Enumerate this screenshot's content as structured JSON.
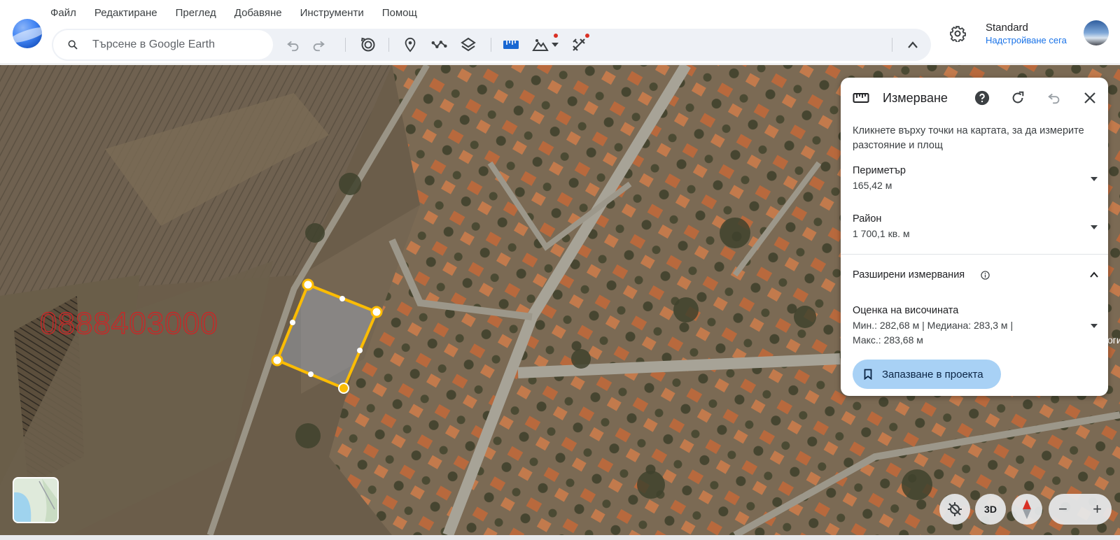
{
  "menu": [
    "Файл",
    "Редактиране",
    "Преглед",
    "Добавяне",
    "Инструменти",
    "Помощ"
  ],
  "search": {
    "placeholder": "Търсене в Google Earth"
  },
  "account": {
    "plan": "Standard",
    "upgrade": "Надстройване сега"
  },
  "map_overlay": {
    "phone": "0888403000",
    "edge_text": "оги"
  },
  "panel": {
    "title": "Измерване",
    "description": "Кликнете върху точки на картата, за да измерите разстояние и площ",
    "perimeter": {
      "label": "Периметър",
      "value": "165,42 м"
    },
    "area": {
      "label": "Район",
      "value": "1 700,1 кв. м"
    },
    "advanced": {
      "label": "Разширени измервания"
    },
    "elevation": {
      "label": "Оценка на височината",
      "value": "Мин.: 282,68 м | Медиана: 283,3 м | Макс.: 283,68 м"
    },
    "save": "Запазване в проекта"
  },
  "controls": {
    "threed": "3D",
    "minus": "−",
    "plus": "+"
  },
  "colors": {
    "accent": "#1a73e8",
    "measure": "#fbbc04",
    "save_bg": "#a8d1f5",
    "alert_dot": "#d93025"
  }
}
